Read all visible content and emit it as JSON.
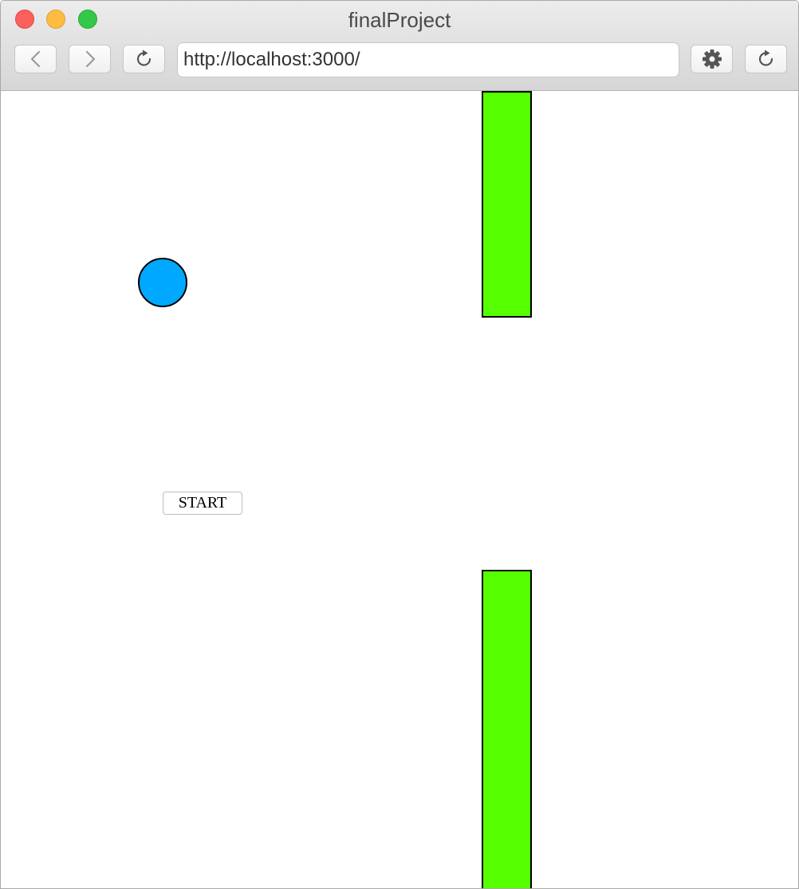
{
  "window": {
    "title": "finalProject"
  },
  "toolbar": {
    "url": "http://localhost:3000/",
    "icons": {
      "back": "chevron-left-icon",
      "forward": "chevron-right-icon",
      "reload": "reload-icon",
      "settings": "gear-icon"
    }
  },
  "game": {
    "start_label": "START",
    "colors": {
      "ball": "#00a8ff",
      "pipe": "#55ff00",
      "outline": "#000000",
      "background": "#ffffff"
    }
  }
}
